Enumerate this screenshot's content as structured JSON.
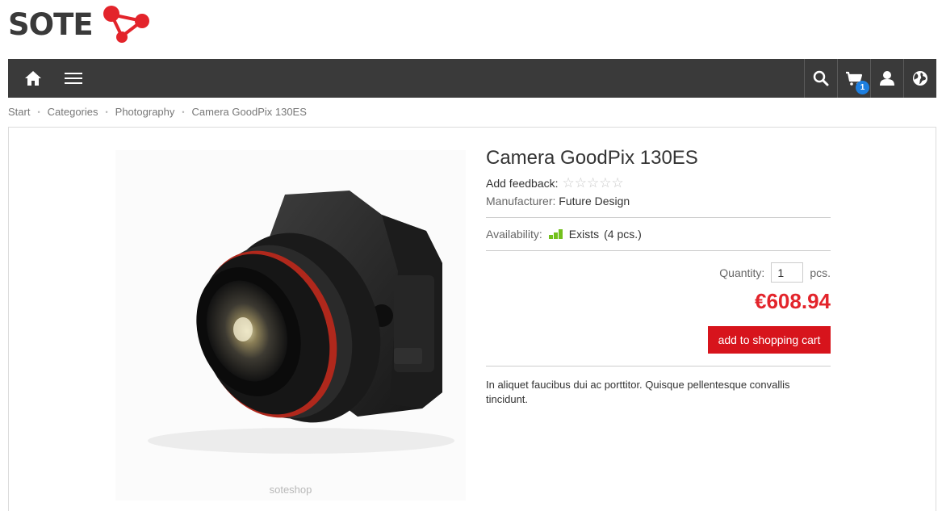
{
  "logo": {
    "text": "SOTE"
  },
  "navbar": {
    "icons": [
      "home-icon",
      "menu-icon",
      "search-icon",
      "cart-icon",
      "user-icon",
      "globe-icon"
    ],
    "cart_count": "1"
  },
  "breadcrumb": [
    {
      "label": "Start"
    },
    {
      "label": "Categories"
    },
    {
      "label": "Photography"
    },
    {
      "label": "Camera GoodPix 130ES"
    }
  ],
  "product": {
    "title": "Camera GoodPix 130ES",
    "feedback_label": "Add feedback:",
    "rating": {
      "value": 0,
      "max": 5,
      "stars": "☆☆☆☆☆"
    },
    "manufacturer_label": "Manufacturer:",
    "manufacturer": "Future Design",
    "availability_label": "Availability:",
    "availability_level": 3,
    "availability_value": "Exists",
    "availability_count": "(4 pcs.)",
    "quantity_label": "Quantity:",
    "quantity_value": "1",
    "quantity_unit": "pcs.",
    "price": "€608.94",
    "add_to_cart_label": "add to shopping cart",
    "description": "In aliquet faucibus dui ac porttitor. Quisque pellentesque convallis tincidunt.",
    "image_watermark": "soteshop"
  },
  "colors": {
    "navbar_bg": "#3a3a3a",
    "brand_red": "#e3242b",
    "button_red": "#d7141c",
    "badge_blue": "#1d7fe0",
    "availability_green": "#73c01d"
  }
}
